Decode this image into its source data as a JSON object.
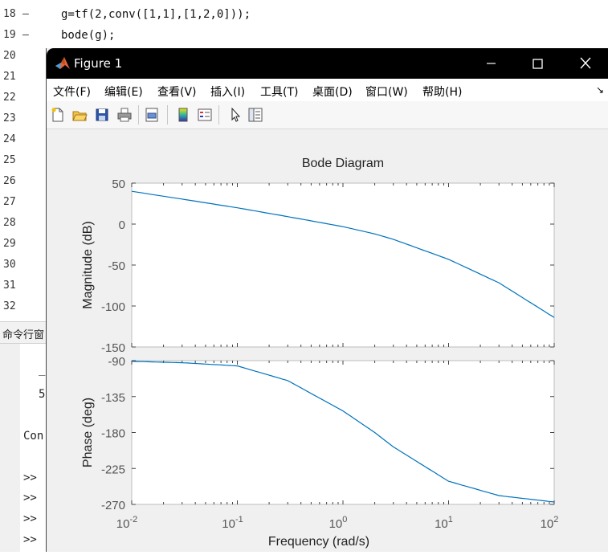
{
  "editor": {
    "lines": [
      {
        "num": "18",
        "dash": "—",
        "code": "g=tf(2,conv([1,1],[1,2,0]));"
      },
      {
        "num": "19",
        "dash": "—",
        "code": "bode(g);"
      },
      {
        "num": "20",
        "dash": "",
        "code": ""
      },
      {
        "num": "21",
        "dash": "",
        "code": ""
      },
      {
        "num": "22",
        "dash": "",
        "code": ""
      },
      {
        "num": "23",
        "dash": "",
        "code": ""
      },
      {
        "num": "24",
        "dash": "",
        "code": ""
      },
      {
        "num": "25",
        "dash": "",
        "code": ""
      },
      {
        "num": "26",
        "dash": "",
        "code": ""
      },
      {
        "num": "27",
        "dash": "",
        "code": ""
      },
      {
        "num": "28",
        "dash": "",
        "code": ""
      },
      {
        "num": "29",
        "dash": "",
        "code": ""
      },
      {
        "num": "30",
        "dash": "",
        "code": ""
      },
      {
        "num": "31",
        "dash": "",
        "code": ""
      },
      {
        "num": "32",
        "dash": "",
        "code": ""
      }
    ]
  },
  "command_window": {
    "title": "命令行窗",
    "lines": [
      "_",
      "5",
      "Con",
      ">>",
      ">>",
      ">>",
      ">>"
    ]
  },
  "figure": {
    "title": "Figure 1",
    "menu": [
      "文件(F)",
      "编辑(E)",
      "查看(V)",
      "插入(I)",
      "工具(T)",
      "桌面(D)",
      "窗口(W)",
      "帮助(H)"
    ],
    "dock_arrow": "↘",
    "toolbar_icons": [
      "new-figure-icon",
      "open-file-icon",
      "save-icon",
      "print-icon",
      "print-preview-icon",
      "colorbar-icon",
      "legend-icon",
      "pointer-icon",
      "property-inspector-icon"
    ]
  },
  "chart_data": {
    "type": "line",
    "title": "Bode Diagram",
    "xlabel": "Frequency  (rad/s)",
    "xscale": "log",
    "xlim": [
      0.01,
      100
    ],
    "x_ticks": [
      {
        "base": "10",
        "exp": "-2"
      },
      {
        "base": "10",
        "exp": "-1"
      },
      {
        "base": "10",
        "exp": "0"
      },
      {
        "base": "10",
        "exp": "1"
      },
      {
        "base": "10",
        "exp": "2"
      }
    ],
    "magnitude": {
      "ylabel": "Magnitude (dB)",
      "ylim": [
        -150,
        50
      ],
      "yticks": [
        "50",
        "0",
        "-50",
        "-100",
        "-150"
      ],
      "x": [
        0.01,
        0.03,
        0.1,
        0.3,
        1,
        2,
        3,
        10,
        30,
        100
      ],
      "y": [
        40,
        30.5,
        19.9,
        9.1,
        -3.1,
        -12.0,
        -18.6,
        -43.0,
        -71.7,
        -114.0
      ]
    },
    "phase": {
      "ylabel": "Phase (deg)",
      "ylim": [
        -270,
        -90
      ],
      "yticks": [
        "-90",
        "-135",
        "-180",
        "-225",
        "-270"
      ],
      "x": [
        0.01,
        0.03,
        0.1,
        0.3,
        1,
        2,
        3,
        10,
        30,
        100
      ],
      "y": [
        -90.9,
        -92.6,
        -86.0,
        -115,
        -153,
        -180,
        -198,
        -241,
        -259,
        -267
      ]
    },
    "grid": false,
    "line_color": "#0072bd"
  }
}
